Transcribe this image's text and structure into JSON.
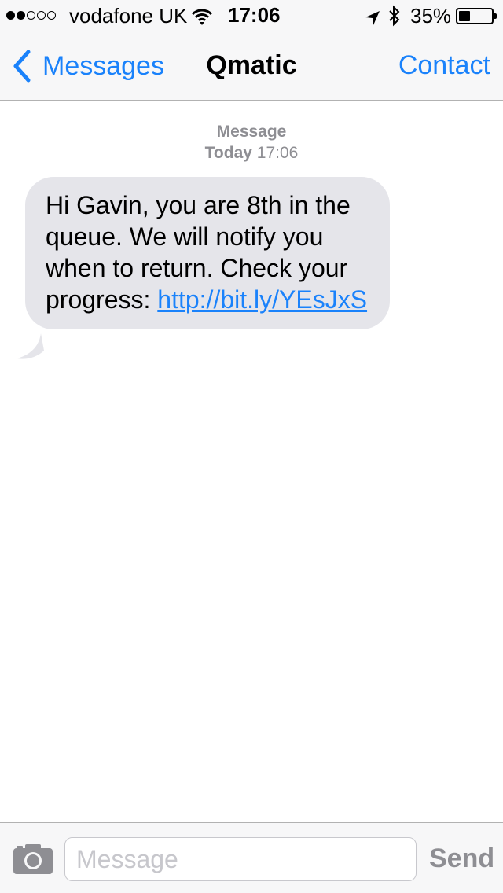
{
  "status_bar": {
    "carrier": "vodafone UK",
    "signal_strength_bars": 2,
    "signal_total_bars": 5,
    "time": "17:06",
    "battery_percent": "35%",
    "battery_level": 0.35,
    "icons": [
      "signal-dots-icon",
      "wifi-icon",
      "location-arrow-icon",
      "bluetooth-icon",
      "battery-icon"
    ]
  },
  "nav": {
    "back_label": "Messages",
    "title": "Qmatic",
    "contact_label": "Contact",
    "accent_color": "#1a82fb"
  },
  "conversation": {
    "header_label": "Message",
    "header_day": "Today",
    "header_time": "17:06",
    "messages": [
      {
        "direction": "incoming",
        "text": "Hi Gavin, you are 8th in the queue. We will notify you when to return. Check your progress: ",
        "link_text": "http://bit.ly/YEsJxS",
        "bubble_color": "#e5e5ea"
      }
    ]
  },
  "composer": {
    "placeholder": "Message",
    "value": "",
    "send_label": "Send",
    "camera_icon": "camera-icon"
  }
}
